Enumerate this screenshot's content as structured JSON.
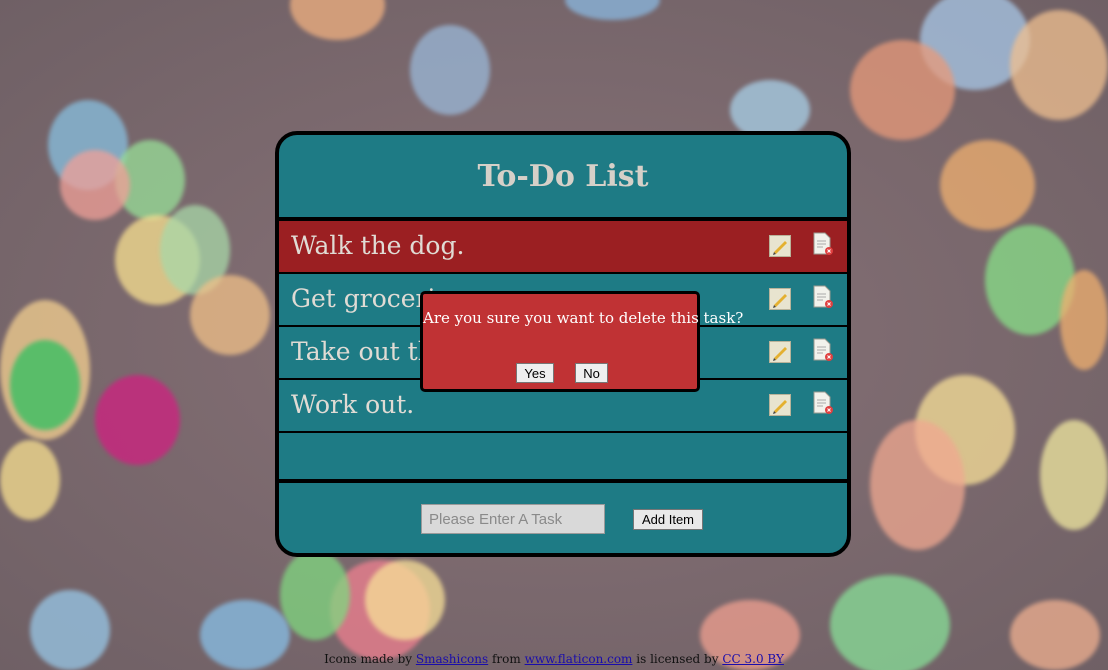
{
  "app": {
    "title": "To-Do List"
  },
  "tasks": [
    {
      "text": "Walk the dog.",
      "selected": true
    },
    {
      "text": "Get groceries.",
      "selected": false
    },
    {
      "text": "Take out the trash.",
      "selected": false
    },
    {
      "text": "Work out.",
      "selected": false
    }
  ],
  "icons": {
    "edit": "pencil-icon",
    "delete": "delete-document-icon"
  },
  "input": {
    "placeholder": "Please Enter A Task",
    "value": ""
  },
  "add_button": {
    "label": "Add Item"
  },
  "dialog": {
    "message": "Are you sure you want to delete this task?",
    "yes_label": "Yes",
    "no_label": "No"
  },
  "footer": {
    "prefix": "Icons made by ",
    "author": "Smashicons",
    "from_text": " from ",
    "site": "www.flaticon.com",
    "license_text": " is licensed by ",
    "license": "CC 3.0 BY"
  },
  "colors": {
    "card": "#1e7b85",
    "selected_row": "#9b1f22",
    "dialog": "#c03234",
    "title_text": "#d6d0c8"
  }
}
